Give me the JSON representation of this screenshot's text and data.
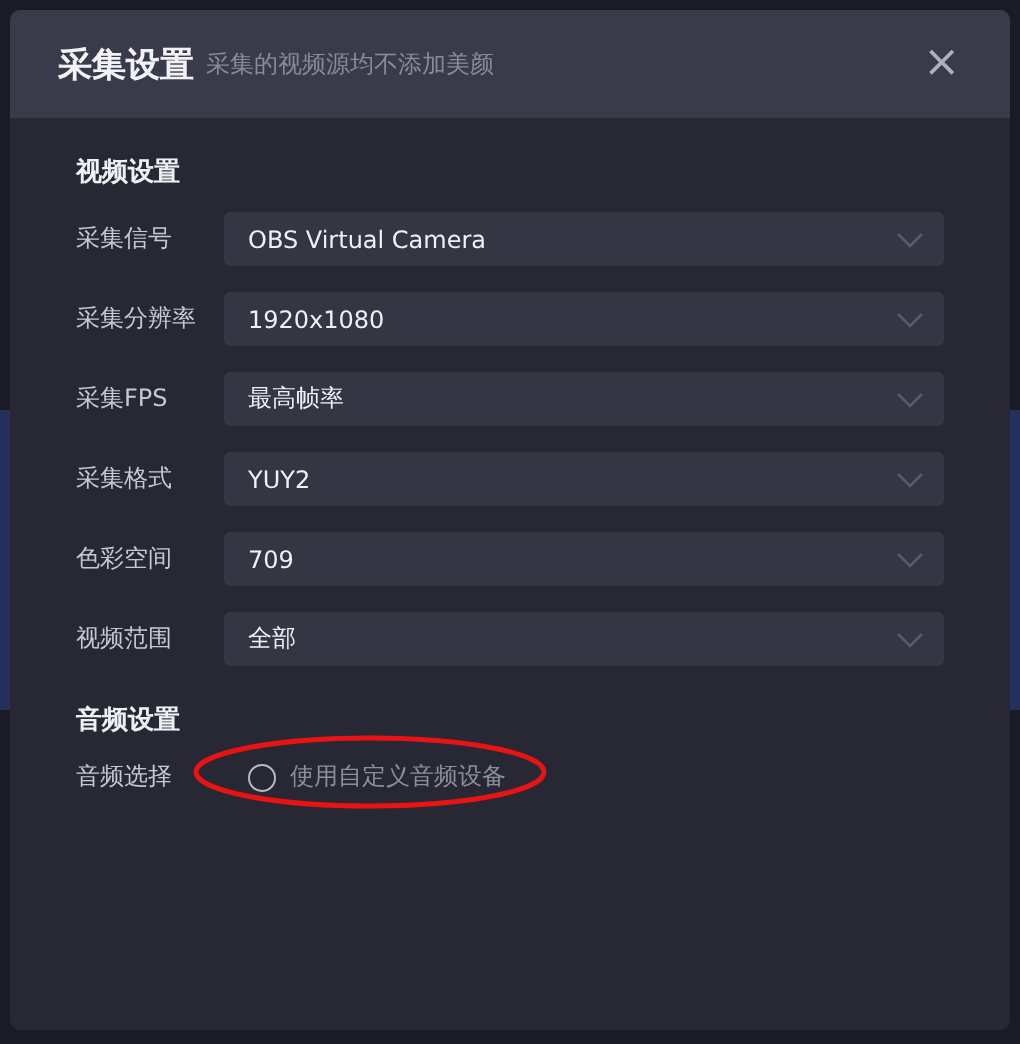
{
  "dialog": {
    "title": "采集设置",
    "subtitle": "采集的视频源均不添加美颜",
    "close": "×"
  },
  "video_section": {
    "title": "视频设置",
    "rows": [
      {
        "label": "采集信号",
        "value": "OBS Virtual Camera"
      },
      {
        "label": "采集分辨率",
        "value": "1920x1080"
      },
      {
        "label": "采集FPS",
        "value": "最高帧率"
      },
      {
        "label": "采集格式",
        "value": "YUY2"
      },
      {
        "label": "色彩空间",
        "value": "709"
      },
      {
        "label": "视频范围",
        "value": "全部"
      }
    ]
  },
  "audio_section": {
    "title": "音频设置",
    "label": "音频选择",
    "option": {
      "label": "使用自定义音频设备",
      "checked": false,
      "circled": true
    }
  }
}
